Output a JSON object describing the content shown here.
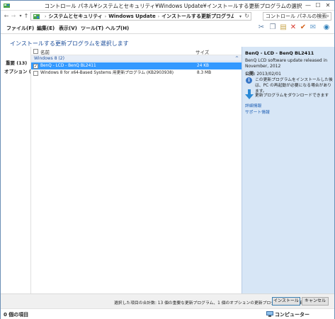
{
  "window": {
    "title": "コントロール パネル¥システムとセキュリティ¥Windows Update¥インストールする更新プログラムの選択",
    "controls": {
      "minimize": "—",
      "maximize": "☐",
      "close": "✕"
    }
  },
  "address": {
    "crumbs": [
      "システムとセキュリティ",
      "Windows Update",
      "インストールする更新プログラムの選択"
    ],
    "search_placeholder": "コントロール パネルの検索"
  },
  "menu": {
    "items": [
      "ファイル(F)",
      "編集(E)",
      "表示(V)",
      "ツール(T)",
      "ヘルプ(H)"
    ]
  },
  "page": {
    "heading": "インストールする更新プログラムを選択します"
  },
  "categories": {
    "important": "重要 (13)",
    "optional": "オプション (2)"
  },
  "list": {
    "header_name": "名前",
    "header_size": "サイズ",
    "group_label": "Windows 8 (2)",
    "group_collapse": "^",
    "rows": [
      {
        "name": "BenQ - LCD - BenQ BL2411",
        "size": "24 KB",
        "checked": true,
        "selected": true
      },
      {
        "name": "Windows 8 for x64-Based Systems 用更新プログラム (KB2903938)",
        "size": "8.3 MB",
        "checked": false,
        "selected": false
      }
    ]
  },
  "detail": {
    "title": "BenQ - LCD - BenQ BL2411",
    "description": "BenQ LCD software update released in November, 2012",
    "published_label": "公開:",
    "published_date": "2013/02/01",
    "note": "この更新プログラムをインストールした後は、PC の再起動が必要になる場合があります。",
    "download_text": "更新プログラムをダウンロードできます",
    "link_details": "詳細情報",
    "link_support": "サポート情報"
  },
  "footer": {
    "summary": "選択した項目の合計数: 13 個の重要な更新プログラム、1 個のオプションの更新プログラム (93.9 MB)",
    "install_label": "インストール",
    "cancel_label": "キャンセル"
  },
  "status": {
    "items": "0 個の項目",
    "location": "コンピューター"
  },
  "colors": {
    "selection": "#3399ff",
    "detail_bg": "#d7e6f6",
    "link": "#1e5fb4",
    "heading": "#1e4f9b"
  }
}
